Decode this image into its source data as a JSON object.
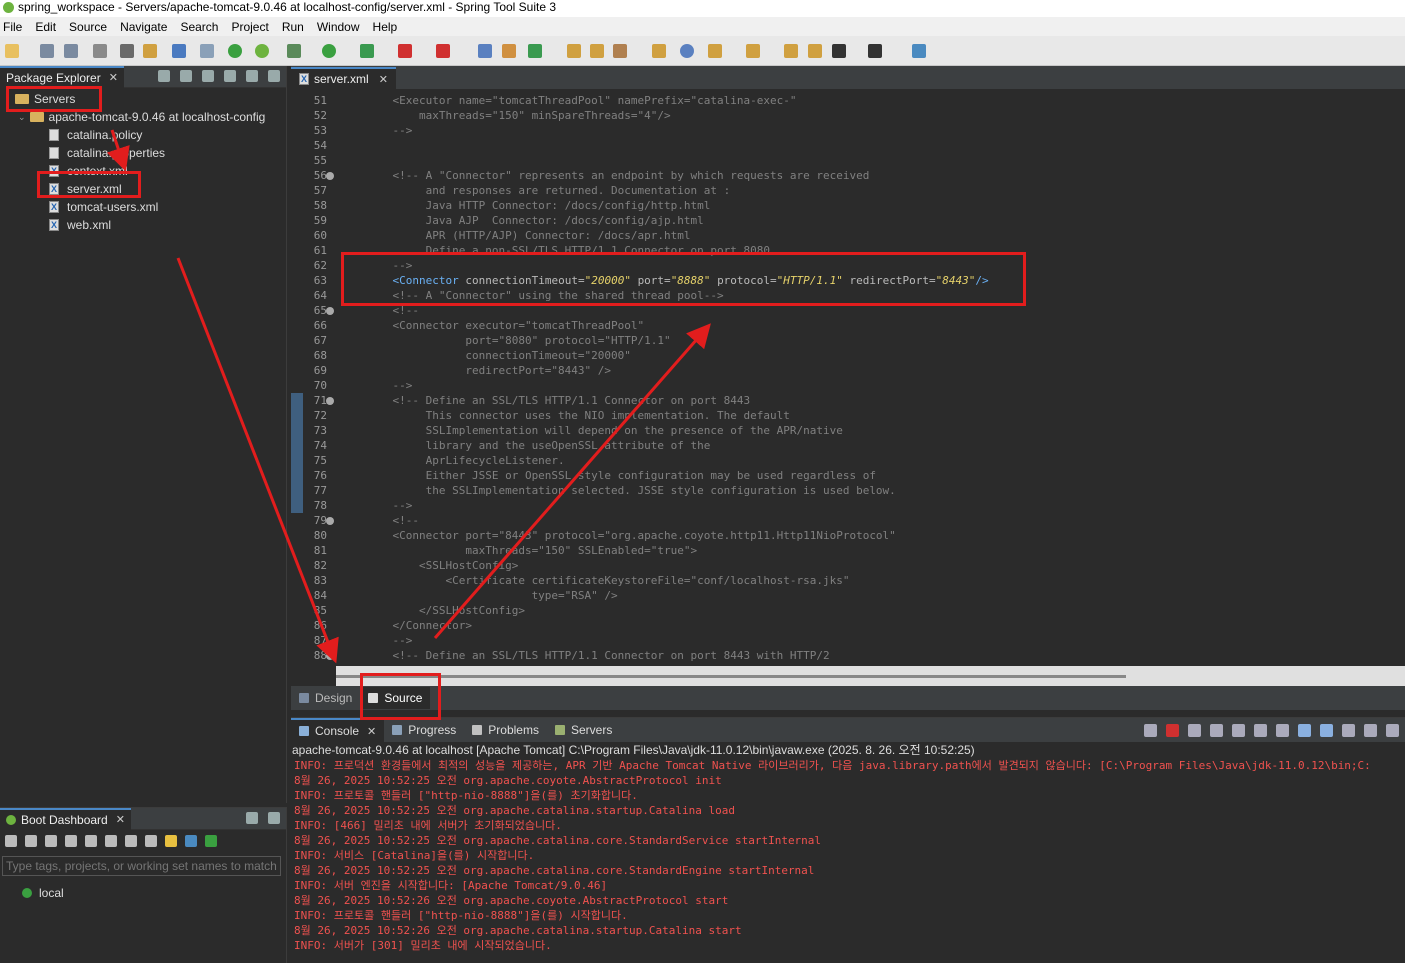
{
  "window": {
    "title": "spring_workspace - Servers/apache-tomcat-9.0.46 at localhost-config/server.xml - Spring Tool Suite 3"
  },
  "menu": [
    "File",
    "Edit",
    "Source",
    "Navigate",
    "Search",
    "Project",
    "Run",
    "Window",
    "Help"
  ],
  "package_explorer": {
    "tab_label": "Package Explorer",
    "tree": [
      {
        "label": "Servers",
        "icon": "folder-icon",
        "level": 0
      },
      {
        "label": "apache-tomcat-9.0.46 at localhost-config",
        "icon": "folder-icon",
        "level": 1
      },
      {
        "label": "catalina.policy",
        "icon": "file-icon",
        "level": 2
      },
      {
        "label": "catalina.properties",
        "icon": "file-icon",
        "level": 2
      },
      {
        "label": "context.xml",
        "icon": "xml-icon",
        "level": 2
      },
      {
        "label": "server.xml",
        "icon": "xml-icon",
        "level": 2
      },
      {
        "label": "tomcat-users.xml",
        "icon": "xml-icon",
        "level": 2
      },
      {
        "label": "web.xml",
        "icon": "xml-icon",
        "level": 2
      }
    ]
  },
  "boot_dashboard": {
    "tab_label": "Boot Dashboard",
    "filter_placeholder": "Type tags, projects, or working set names to match",
    "items": [
      "local"
    ]
  },
  "editor": {
    "tab_label": "server.xml",
    "lines": [
      {
        "n": "51",
        "t": "    <Executor name=\"tomcatThreadPool\" namePrefix=\"catalina-exec-\""
      },
      {
        "n": "52",
        "t": "        maxThreads=\"150\" minSpareThreads=\"4\"/>"
      },
      {
        "n": "53",
        "t": "    -->"
      },
      {
        "n": "54",
        "t": ""
      },
      {
        "n": "55",
        "t": ""
      },
      {
        "n": "56",
        "t": "    <!-- A \"Connector\" represents an endpoint by which requests are received",
        "fold": true
      },
      {
        "n": "57",
        "t": "         and responses are returned. Documentation at :"
      },
      {
        "n": "58",
        "t": "         Java HTTP Connector: /docs/config/http.html"
      },
      {
        "n": "59",
        "t": "         Java AJP  Connector: /docs/config/ajp.html"
      },
      {
        "n": "60",
        "t": "         APR (HTTP/AJP) Connector: /docs/apr.html"
      },
      {
        "n": "61",
        "t": "         Define a non-SSL/TLS HTTP/1.1 Connector on port 8080"
      },
      {
        "n": "62",
        "t": "    -->"
      },
      {
        "n": "63",
        "t": "",
        "connector": true
      },
      {
        "n": "64",
        "t": "    <!-- A \"Connector\" using the shared thread pool-->"
      },
      {
        "n": "65",
        "t": "    <!--",
        "fold": true
      },
      {
        "n": "66",
        "t": "    <Connector executor=\"tomcatThreadPool\""
      },
      {
        "n": "67",
        "t": "               port=\"8080\" protocol=\"HTTP/1.1\""
      },
      {
        "n": "68",
        "t": "               connectionTimeout=\"20000\""
      },
      {
        "n": "69",
        "t": "               redirectPort=\"8443\" />"
      },
      {
        "n": "70",
        "t": "    -->"
      },
      {
        "n": "71",
        "t": "    <!-- Define an SSL/TLS HTTP/1.1 Connector on port 8443",
        "fold": true
      },
      {
        "n": "72",
        "t": "         This connector uses the NIO implementation. The default"
      },
      {
        "n": "73",
        "t": "         SSLImplementation will depend on the presence of the APR/native"
      },
      {
        "n": "74",
        "t": "         library and the useOpenSSL attribute of the"
      },
      {
        "n": "75",
        "t": "         AprLifecycleListener."
      },
      {
        "n": "76",
        "t": "         Either JSSE or OpenSSL style configuration may be used regardless of"
      },
      {
        "n": "77",
        "t": "         the SSLImplementation selected. JSSE style configuration is used below."
      },
      {
        "n": "78",
        "t": "    -->"
      },
      {
        "n": "79",
        "t": "    <!--",
        "fold": true
      },
      {
        "n": "80",
        "t": "    <Connector port=\"8443\" protocol=\"org.apache.coyote.http11.Http11NioProtocol\""
      },
      {
        "n": "81",
        "t": "               maxThreads=\"150\" SSLEnabled=\"true\">"
      },
      {
        "n": "82",
        "t": "        <SSLHostConfig>"
      },
      {
        "n": "83",
        "t": "            <Certificate certificateKeystoreFile=\"conf/localhost-rsa.jks\""
      },
      {
        "n": "84",
        "t": "                         type=\"RSA\" />"
      },
      {
        "n": "85",
        "t": "        </SSLHostConfig>"
      },
      {
        "n": "86",
        "t": "    </Connector>"
      },
      {
        "n": "87",
        "t": "    -->"
      },
      {
        "n": "88",
        "t": "    <!-- Define an SSL/TLS HTTP/1.1 Connector on port 8443 with HTTP/2",
        "fold": true
      }
    ],
    "connector": {
      "open": "<Connector",
      "a1": "connectionTimeout=",
      "v1": "\"20000\"",
      "a2": "port=",
      "v2": "\"8888\"",
      "a3": "protocol=",
      "v3": "\"HTTP/1.1\"",
      "a4": "redirectPort=",
      "v4": "\"8443\"",
      "close": "/>"
    }
  },
  "source_tabs": [
    "Design",
    "Source"
  ],
  "console": {
    "tabs": [
      "Console",
      "Progress",
      "Problems",
      "Servers"
    ],
    "description": "apache-tomcat-9.0.46 at localhost [Apache Tomcat] C:\\Program Files\\Java\\jdk-11.0.12\\bin\\javaw.exe  (2025. 8. 26. 오전 10:52:25)",
    "lines": [
      "INFO: 프로덕션 환경들에서 최적의 성능을 제공하는, APR 기반 Apache Tomcat Native 라이브러리가, 다음 java.library.path에서 발견되지 않습니다: [C:\\Program Files\\Java\\jdk-11.0.12\\bin;C:",
      "8월 26, 2025 10:52:25 오전 org.apache.coyote.AbstractProtocol init",
      "INFO: 프로토콜 핸들러 [\"http-nio-8888\"]을(를) 초기화합니다.",
      "8월 26, 2025 10:52:25 오전 org.apache.catalina.startup.Catalina load",
      "INFO: [466] 밀리초 내에 서버가 초기화되었습니다.",
      "8월 26, 2025 10:52:25 오전 org.apache.catalina.core.StandardService startInternal",
      "INFO: 서비스 [Catalina]을(를) 시작합니다.",
      "8월 26, 2025 10:52:25 오전 org.apache.catalina.core.StandardEngine startInternal",
      "INFO: 서버 엔진을 시작합니다: [Apache Tomcat/9.0.46]",
      "8월 26, 2025 10:52:26 오전 org.apache.coyote.AbstractProtocol start",
      "INFO: 프로토콜 핸들러 [\"http-nio-8888\"]을(를) 시작합니다.",
      "8월 26, 2025 10:52:26 오전 org.apache.catalina.startup.Catalina start",
      "INFO: 서버가 [301] 밀리초 내에 시작되었습니다."
    ]
  },
  "colors": {
    "annotation": "#e21d1d",
    "console_text": "#f0524f",
    "accent": "#4a88c7"
  }
}
